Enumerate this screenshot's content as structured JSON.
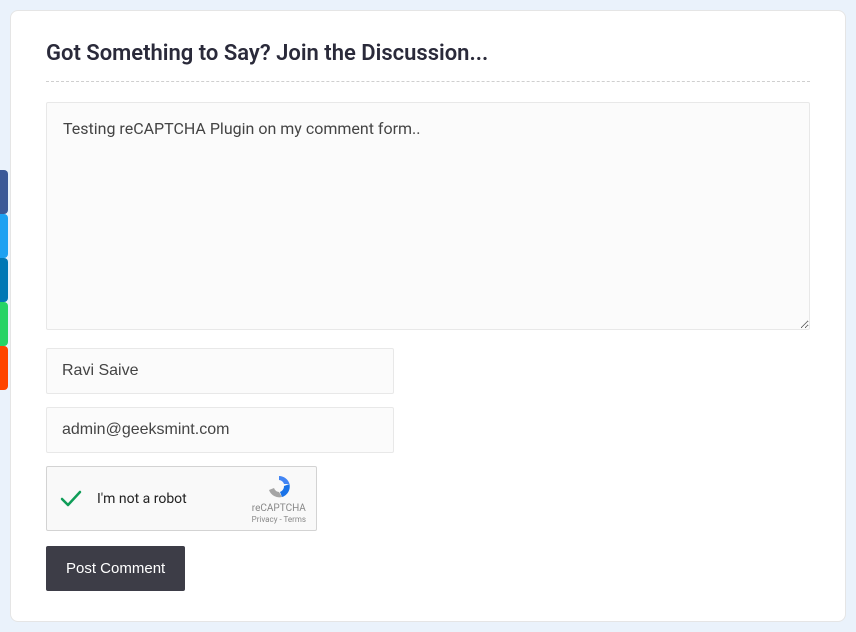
{
  "heading": "Got Something to Say? Join the Discussion...",
  "comment_text": "Testing reCAPTCHA Plugin on my comment form..",
  "name_value": "Ravi Saive",
  "email_value": "admin@geeksmint.com",
  "recaptcha": {
    "label": "I'm not a robot",
    "brand": "reCAPTCHA",
    "privacy": "Privacy",
    "terms": "Terms"
  },
  "submit_label": "Post Comment"
}
